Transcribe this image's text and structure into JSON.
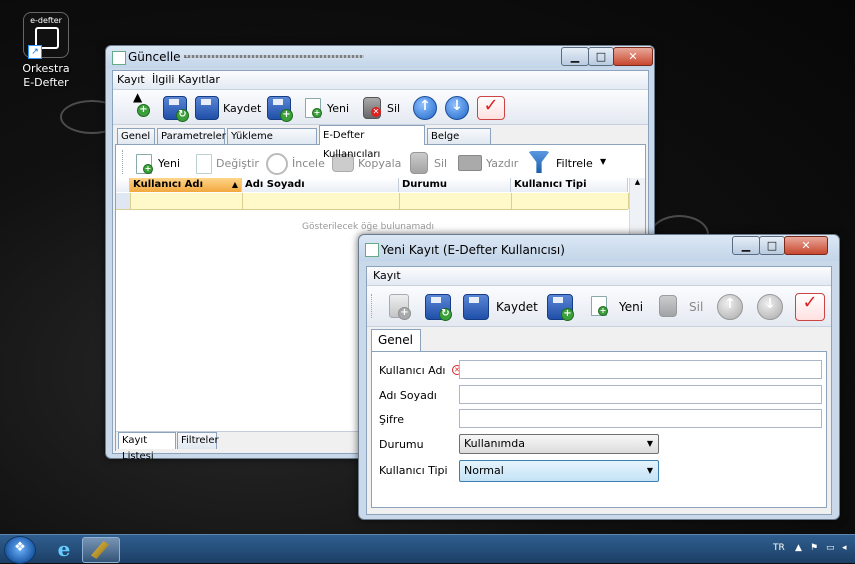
{
  "desktop": {
    "icon_label_line1": "Orkestra",
    "icon_label_line2": "E-Defter",
    "icon_text": "e-defter"
  },
  "main_window": {
    "title": "Güncelle -",
    "menu": [
      "Kayıt",
      "İlgili Kayıtlar"
    ],
    "toolbar": {
      "save_label": "Kaydet",
      "new_label": "Yeni",
      "delete_label": "Sil"
    },
    "tabs": [
      "Genel",
      "Parametreler",
      "Yükleme Tanımları",
      "E-Defter Kullanıcıları",
      "Belge Tipleri"
    ],
    "active_tab": "E-Defter Kullanıcıları",
    "subtoolbar": {
      "new": "Yeni",
      "edit": "Değiştir",
      "view": "İncele",
      "copy": "Kopyala",
      "delete": "Sil",
      "print": "Yazdır",
      "filter": "Filtrele"
    },
    "grid": {
      "columns": [
        "Kullanıcı Adı",
        "Adı Soyadı",
        "Durumu",
        "Kullanıcı Tipi"
      ],
      "empty_text": "Gösterilecek öğe bulunamadı",
      "sorted_column": "Kullanıcı Adı"
    },
    "bottom_tabs": [
      "Kayıt Listesi",
      "Filtreler"
    ]
  },
  "dialog": {
    "title": "Yeni Kayıt (E-Defter Kullanıcısı)",
    "menu": [
      "Kayıt"
    ],
    "toolbar": {
      "save_label": "Kaydet",
      "new_label": "Yeni",
      "delete_label": "Sil"
    },
    "tabs": [
      "Genel"
    ],
    "form": {
      "username_label": "Kullanıcı Adı",
      "fullname_label": "Adı Soyadı",
      "password_label": "Şifre",
      "status_label": "Durumu",
      "status_value": "Kullanımda",
      "usertype_label": "Kullanıcı Tipi",
      "usertype_value": "Normal"
    }
  },
  "taskbar": {
    "language": "TR"
  },
  "colors": {
    "accent_blue": "#1f4fa8",
    "sorted_header": "#f2a83e",
    "filter_row": "#fff8c8",
    "close_red": "#c8472f"
  }
}
